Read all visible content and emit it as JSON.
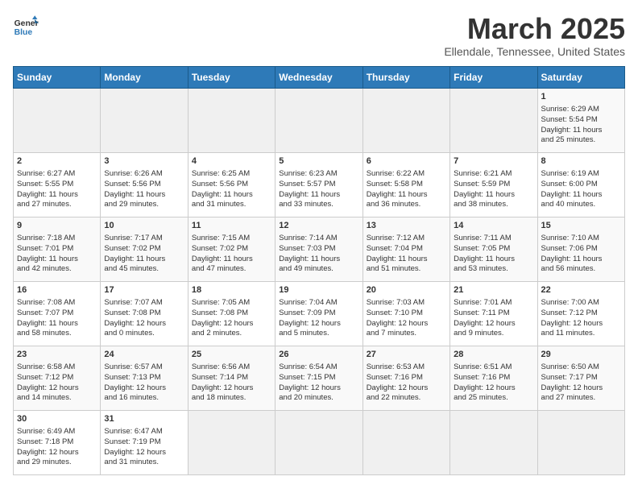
{
  "header": {
    "logo_line1": "General",
    "logo_line2": "Blue",
    "title": "March 2025",
    "subtitle": "Ellendale, Tennessee, United States"
  },
  "days_of_week": [
    "Sunday",
    "Monday",
    "Tuesday",
    "Wednesday",
    "Thursday",
    "Friday",
    "Saturday"
  ],
  "weeks": [
    [
      {
        "day": "",
        "info": ""
      },
      {
        "day": "",
        "info": ""
      },
      {
        "day": "",
        "info": ""
      },
      {
        "day": "",
        "info": ""
      },
      {
        "day": "",
        "info": ""
      },
      {
        "day": "",
        "info": ""
      },
      {
        "day": "1",
        "info": "Sunrise: 6:29 AM\nSunset: 5:54 PM\nDaylight: 11 hours\nand 25 minutes."
      }
    ],
    [
      {
        "day": "2",
        "info": "Sunrise: 6:27 AM\nSunset: 5:55 PM\nDaylight: 11 hours\nand 27 minutes."
      },
      {
        "day": "3",
        "info": "Sunrise: 6:26 AM\nSunset: 5:56 PM\nDaylight: 11 hours\nand 29 minutes."
      },
      {
        "day": "4",
        "info": "Sunrise: 6:25 AM\nSunset: 5:56 PM\nDaylight: 11 hours\nand 31 minutes."
      },
      {
        "day": "5",
        "info": "Sunrise: 6:23 AM\nSunset: 5:57 PM\nDaylight: 11 hours\nand 33 minutes."
      },
      {
        "day": "6",
        "info": "Sunrise: 6:22 AM\nSunset: 5:58 PM\nDaylight: 11 hours\nand 36 minutes."
      },
      {
        "day": "7",
        "info": "Sunrise: 6:21 AM\nSunset: 5:59 PM\nDaylight: 11 hours\nand 38 minutes."
      },
      {
        "day": "8",
        "info": "Sunrise: 6:19 AM\nSunset: 6:00 PM\nDaylight: 11 hours\nand 40 minutes."
      }
    ],
    [
      {
        "day": "9",
        "info": "Sunrise: 7:18 AM\nSunset: 7:01 PM\nDaylight: 11 hours\nand 42 minutes."
      },
      {
        "day": "10",
        "info": "Sunrise: 7:17 AM\nSunset: 7:02 PM\nDaylight: 11 hours\nand 45 minutes."
      },
      {
        "day": "11",
        "info": "Sunrise: 7:15 AM\nSunset: 7:02 PM\nDaylight: 11 hours\nand 47 minutes."
      },
      {
        "day": "12",
        "info": "Sunrise: 7:14 AM\nSunset: 7:03 PM\nDaylight: 11 hours\nand 49 minutes."
      },
      {
        "day": "13",
        "info": "Sunrise: 7:12 AM\nSunset: 7:04 PM\nDaylight: 11 hours\nand 51 minutes."
      },
      {
        "day": "14",
        "info": "Sunrise: 7:11 AM\nSunset: 7:05 PM\nDaylight: 11 hours\nand 53 minutes."
      },
      {
        "day": "15",
        "info": "Sunrise: 7:10 AM\nSunset: 7:06 PM\nDaylight: 11 hours\nand 56 minutes."
      }
    ],
    [
      {
        "day": "16",
        "info": "Sunrise: 7:08 AM\nSunset: 7:07 PM\nDaylight: 11 hours\nand 58 minutes."
      },
      {
        "day": "17",
        "info": "Sunrise: 7:07 AM\nSunset: 7:08 PM\nDaylight: 12 hours\nand 0 minutes."
      },
      {
        "day": "18",
        "info": "Sunrise: 7:05 AM\nSunset: 7:08 PM\nDaylight: 12 hours\nand 2 minutes."
      },
      {
        "day": "19",
        "info": "Sunrise: 7:04 AM\nSunset: 7:09 PM\nDaylight: 12 hours\nand 5 minutes."
      },
      {
        "day": "20",
        "info": "Sunrise: 7:03 AM\nSunset: 7:10 PM\nDaylight: 12 hours\nand 7 minutes."
      },
      {
        "day": "21",
        "info": "Sunrise: 7:01 AM\nSunset: 7:11 PM\nDaylight: 12 hours\nand 9 minutes."
      },
      {
        "day": "22",
        "info": "Sunrise: 7:00 AM\nSunset: 7:12 PM\nDaylight: 12 hours\nand 11 minutes."
      }
    ],
    [
      {
        "day": "23",
        "info": "Sunrise: 6:58 AM\nSunset: 7:12 PM\nDaylight: 12 hours\nand 14 minutes."
      },
      {
        "day": "24",
        "info": "Sunrise: 6:57 AM\nSunset: 7:13 PM\nDaylight: 12 hours\nand 16 minutes."
      },
      {
        "day": "25",
        "info": "Sunrise: 6:56 AM\nSunset: 7:14 PM\nDaylight: 12 hours\nand 18 minutes."
      },
      {
        "day": "26",
        "info": "Sunrise: 6:54 AM\nSunset: 7:15 PM\nDaylight: 12 hours\nand 20 minutes."
      },
      {
        "day": "27",
        "info": "Sunrise: 6:53 AM\nSunset: 7:16 PM\nDaylight: 12 hours\nand 22 minutes."
      },
      {
        "day": "28",
        "info": "Sunrise: 6:51 AM\nSunset: 7:16 PM\nDaylight: 12 hours\nand 25 minutes."
      },
      {
        "day": "29",
        "info": "Sunrise: 6:50 AM\nSunset: 7:17 PM\nDaylight: 12 hours\nand 27 minutes."
      }
    ],
    [
      {
        "day": "30",
        "info": "Sunrise: 6:49 AM\nSunset: 7:18 PM\nDaylight: 12 hours\nand 29 minutes."
      },
      {
        "day": "31",
        "info": "Sunrise: 6:47 AM\nSunset: 7:19 PM\nDaylight: 12 hours\nand 31 minutes."
      },
      {
        "day": "",
        "info": ""
      },
      {
        "day": "",
        "info": ""
      },
      {
        "day": "",
        "info": ""
      },
      {
        "day": "",
        "info": ""
      },
      {
        "day": "",
        "info": ""
      }
    ]
  ]
}
